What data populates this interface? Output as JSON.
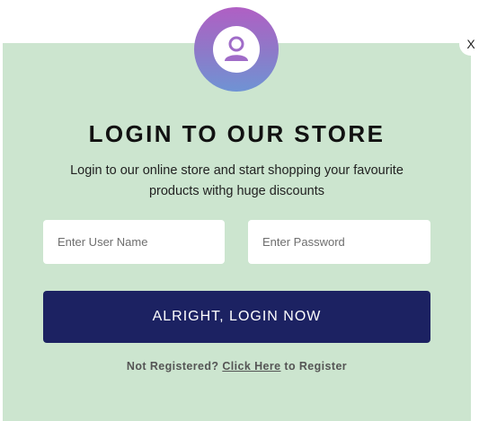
{
  "modal": {
    "close_label": "X",
    "title": "LOGIN TO OUR STORE",
    "subtitle": "Login to our online store and start shopping your favourite products withg huge discounts",
    "fields": {
      "username_placeholder": "Enter User Name",
      "password_placeholder": "Enter Password"
    },
    "login_label": "ALRIGHT, LOGIN NOW",
    "register": {
      "prefix": "Not Registered?",
      "link": "Click Here",
      "suffix": "to Register"
    }
  },
  "icons": {
    "avatar": "user-icon",
    "close": "close-icon"
  },
  "colors": {
    "modal_bg": "#cce5cf",
    "button_bg": "#1c2262",
    "avatar_gradient_top": "#b05fc4",
    "avatar_gradient_bottom": "#6f93d4"
  }
}
